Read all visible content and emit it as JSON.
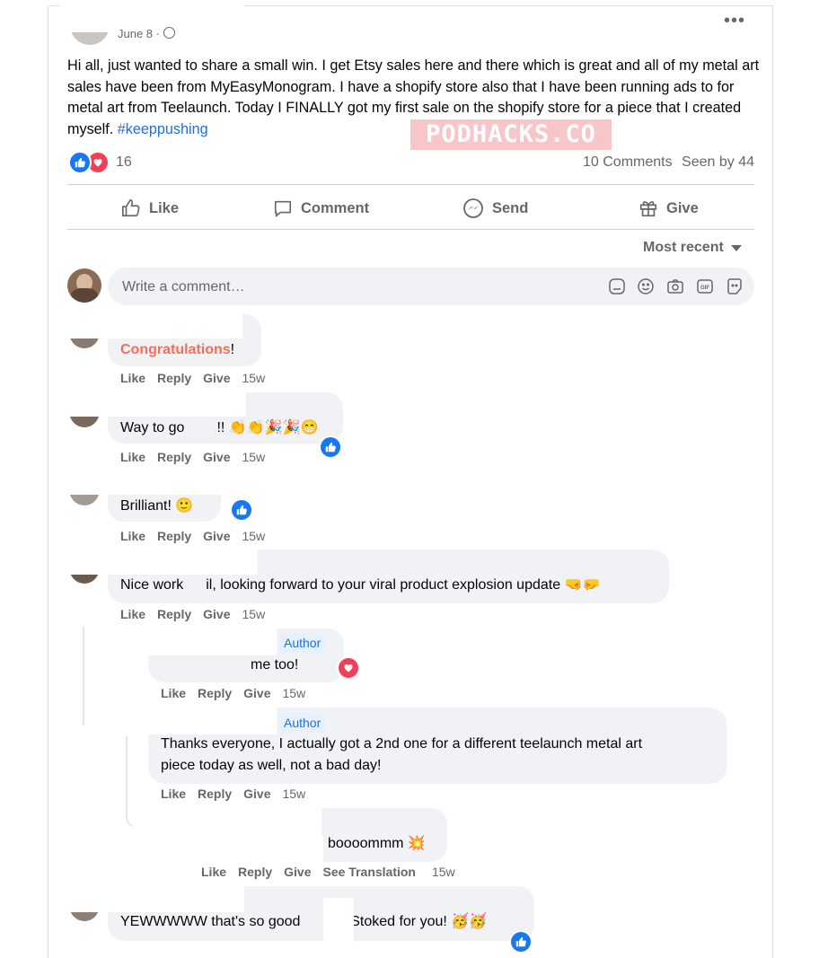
{
  "post": {
    "date": "June 8",
    "privacy_icon": "group-globe-icon",
    "text_main": "Hi all, just wanted to share a small win.  I get Etsy sales here and there which is great and all of my metal art sales have been from MyEasyMonogram. I have a shopify store also that I have been running ads to for metal art from Teelaunch. Today I FINALLY got my first sale on the shopify store for a piece that I created myself. ",
    "hashtag": "#keeppushing",
    "watermark": "PODHACKS.CO",
    "reaction_icons": [
      "like-icon",
      "love-icon"
    ],
    "reaction_count": "16",
    "comments_count": "10 Comments",
    "seen_by": "Seen by 44"
  },
  "actions": {
    "like": "Like",
    "comment": "Comment",
    "send": "Send",
    "give": "Give"
  },
  "sort_label": "Most recent",
  "composer": {
    "placeholder": "Write a comment…",
    "icons": [
      "sticker-icon",
      "emoji-icon",
      "camera-icon",
      "gif-icon",
      "avatar-sticker-icon"
    ]
  },
  "comment_actions": {
    "like": "Like",
    "reply": "Reply",
    "give": "Give",
    "see_translation": "See Translation"
  },
  "author_badge": "Author",
  "comments": [
    {
      "text": "Congratulations",
      "suffix": "!",
      "time": "15w"
    },
    {
      "text": "Way to go",
      "suffix": "!! 👏👏🎉🎉😁",
      "time": "15w",
      "reaction": "like"
    },
    {
      "text": "Brilliant! 🙂",
      "time": "15w",
      "reaction": "like"
    },
    {
      "text": "Nice work",
      "suffix": "il, looking forward to your viral product explosion update 🤜🤛",
      "time": "15w"
    },
    {
      "text": "me too!",
      "time": "15w",
      "reaction": "love"
    },
    {
      "line1": "Thanks everyone, I actually got a 2nd one for a different teelaunch metal art",
      "line2": "piece today as well, not a bad day!",
      "time": "15w"
    },
    {
      "text": "boooommm 💥",
      "time": "15w"
    },
    {
      "text": "YEWWWWW that's so good",
      "suffix": "!!! Stoked for you! 🥳🥳",
      "reaction": "like"
    }
  ]
}
